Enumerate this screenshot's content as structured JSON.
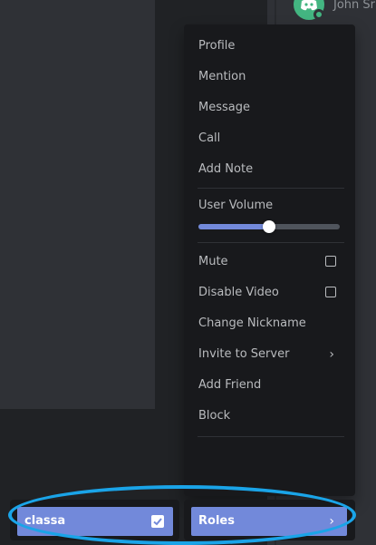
{
  "member": {
    "name": "John Sr"
  },
  "context_menu": {
    "items": [
      {
        "label": "Profile"
      },
      {
        "label": "Mention"
      },
      {
        "label": "Message"
      },
      {
        "label": "Call"
      },
      {
        "label": "Add Note"
      }
    ],
    "volume": {
      "label": "User Volume",
      "level": 0.5
    },
    "toggles": [
      {
        "label": "Mute",
        "checked": false
      },
      {
        "label": "Disable Video",
        "checked": false
      }
    ],
    "more_items": [
      {
        "label": "Change Nickname"
      },
      {
        "label": "Invite to Server",
        "has_submenu": true
      },
      {
        "label": "Add Friend"
      },
      {
        "label": "Block"
      }
    ]
  },
  "roles_bar": {
    "role_name": "classa",
    "role_checked": true,
    "roles_label": "Roles"
  },
  "colors": {
    "accent": "#7289da",
    "highlight": "#1aa4e8",
    "online": "#43b581",
    "menu_bg": "#18191c"
  },
  "icons": {
    "submenu": "chevron-right-icon",
    "check": "checkmark-icon",
    "avatar": "discord-logo-icon"
  }
}
